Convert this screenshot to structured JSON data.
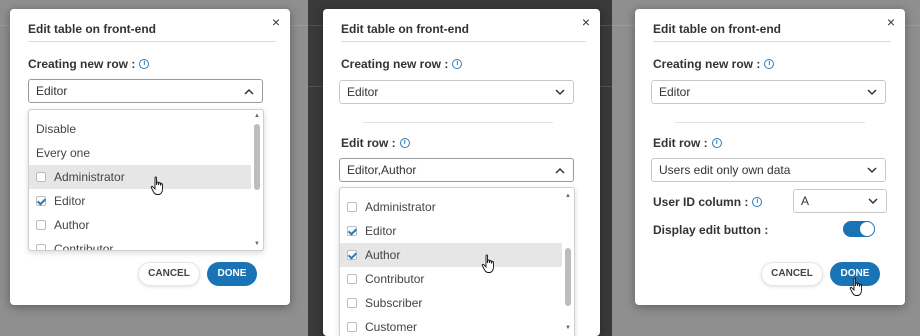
{
  "panel1": {
    "title": "Edit table on front-end",
    "close": "×",
    "creating_label": "Creating new row :",
    "creating_value": "Editor",
    "options": [
      {
        "label": "Disable",
        "checkbox": false,
        "checked": false
      },
      {
        "label": "Every one",
        "checkbox": false,
        "checked": false
      },
      {
        "label": "Administrator",
        "checkbox": true,
        "checked": false
      },
      {
        "label": "Editor",
        "checkbox": true,
        "checked": true
      },
      {
        "label": "Author",
        "checkbox": true,
        "checked": false
      },
      {
        "label": "Contributor",
        "checkbox": true,
        "checked": false
      }
    ],
    "cancel": "CANCEL",
    "done": "DONE"
  },
  "panel2": {
    "title": "Edit table on front-end",
    "close": "×",
    "creating_label": "Creating new row :",
    "creating_value": "Editor",
    "edit_label": "Edit row :",
    "edit_value": "Editor,Author",
    "options": [
      {
        "label": "Administrator",
        "checked": false
      },
      {
        "label": "Editor",
        "checked": true
      },
      {
        "label": "Author",
        "checked": true
      },
      {
        "label": "Contributor",
        "checked": false
      },
      {
        "label": "Subscriber",
        "checked": false
      },
      {
        "label": "Customer",
        "checked": false
      }
    ]
  },
  "panel3": {
    "title": "Edit table on front-end",
    "close": "×",
    "creating_label": "Creating new row :",
    "creating_value": "Editor",
    "edit_label": "Edit row :",
    "edit_value": "Users edit only own data",
    "user_id_label": "User ID column :",
    "user_id_value": "A",
    "display_edit_label": "Display edit button :",
    "display_edit_on": true,
    "cancel": "CANCEL",
    "done": "DONE"
  },
  "icons": {
    "info": "i"
  },
  "colors": {
    "accent": "#1a73b5",
    "info": "#2b7bb9"
  }
}
